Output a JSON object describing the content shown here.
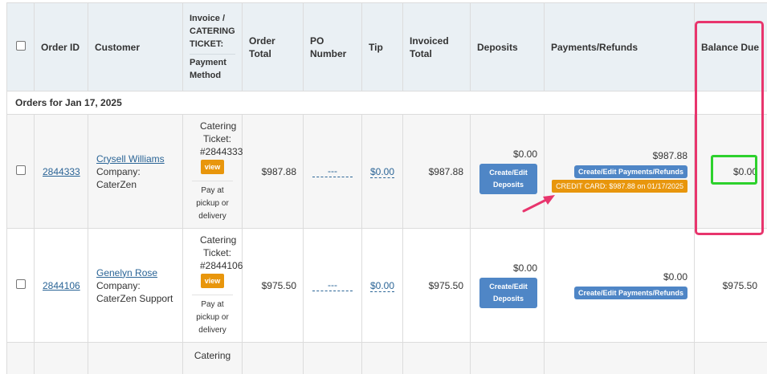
{
  "headers": {
    "order_id": "Order ID",
    "customer": "Customer",
    "invoice_top": "Invoice / CATERING TICKET:",
    "invoice_bottom": "Payment Method",
    "order_total": "Order Total",
    "po_number": "PO Number",
    "tip": "Tip",
    "invoiced_total": "Invoiced Total",
    "deposits": "Deposits",
    "payments": "Payments/Refunds",
    "balance_due": "Balance Due"
  },
  "group_label": "Orders for Jan 17, 2025",
  "orders": [
    {
      "id": "2844333",
      "customer_name": "Crysell Williams",
      "company": "Company: CaterZen",
      "ticket_label": "Catering Ticket: #2844333",
      "view_label": "view",
      "pay_method": "Pay at pickup or delivery",
      "order_total": "$987.88",
      "po": "---",
      "tip": "$0.00",
      "invoiced_total": "$987.88",
      "deposit_amount": "$0.00",
      "deposit_button": "Create/Edit Deposits",
      "payment_amount": "$987.88",
      "payment_button": "Create/Edit Payments/Refunds",
      "credit_badge": "CREDIT CARD: $987.88 on 01/17/2025",
      "balance_due": "$0.00"
    },
    {
      "id": "2844106",
      "customer_name": "Genelyn Rose",
      "company": "Company: CaterZen Support",
      "ticket_label": "Catering Ticket: #2844106",
      "view_label": "view",
      "pay_method": "Pay at pickup or delivery",
      "order_total": "$975.50",
      "po": "---",
      "tip": "$0.00",
      "invoiced_total": "$975.50",
      "deposit_amount": "$0.00",
      "deposit_button": "Create/Edit Deposits",
      "payment_amount": "$0.00",
      "payment_button": "Create/Edit Payments/Refunds",
      "balance_due": "$975.50"
    }
  ],
  "partial_row_text": "Catering",
  "colors": {
    "header_bg": "#eaf0f4",
    "link": "#2a6496",
    "button_blue": "#4f86c6",
    "badge_orange": "#e8960c",
    "highlight_pink": "#e8356d",
    "highlight_green": "#2dd12d"
  }
}
